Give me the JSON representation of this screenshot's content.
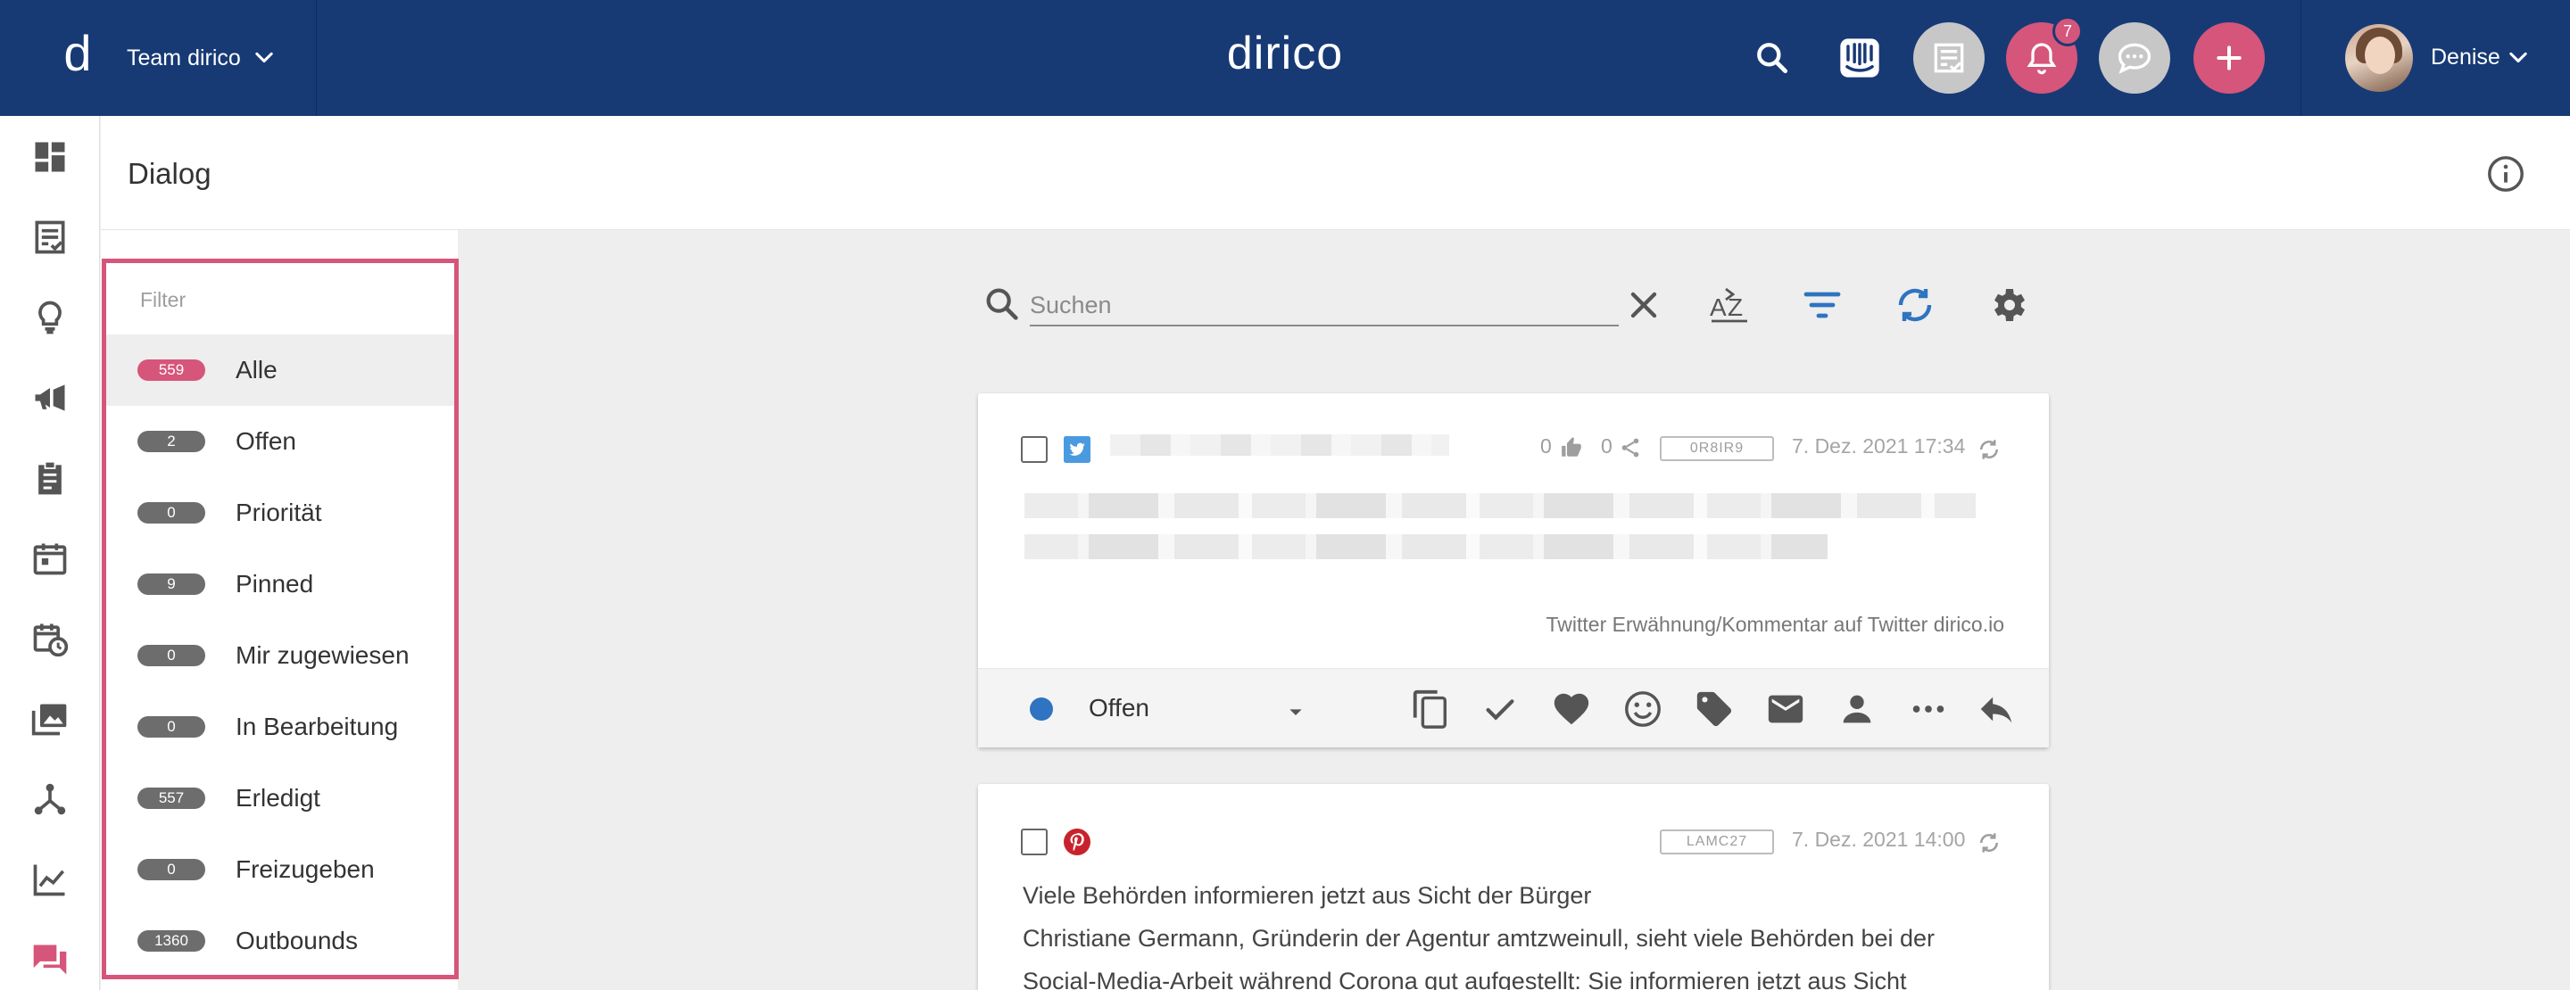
{
  "topbar": {
    "logo_letter": "d",
    "team_name": "Team dirico",
    "brand": "dirico",
    "notification_count": "7",
    "user_name": "Denise"
  },
  "header": {
    "title": "Dialog"
  },
  "filter": {
    "label": "Filter",
    "items": [
      {
        "count": "559",
        "label": "Alle"
      },
      {
        "count": "2",
        "label": "Offen"
      },
      {
        "count": "0",
        "label": "Priorität"
      },
      {
        "count": "9",
        "label": "Pinned"
      },
      {
        "count": "0",
        "label": "Mir zugewiesen"
      },
      {
        "count": "0",
        "label": "In Bearbeitung"
      },
      {
        "count": "557",
        "label": "Erledigt"
      },
      {
        "count": "0",
        "label": "Freizugeben"
      },
      {
        "count": "1360",
        "label": "Outbounds"
      }
    ]
  },
  "search": {
    "placeholder": "Suchen",
    "value": ""
  },
  "posts": [
    {
      "network": "twitter-icon",
      "likes": "0",
      "shares": "0",
      "id": "0R8IR9",
      "date": "7. Dez. 2021 17:34",
      "source": "Twitter Erwähnung/Kommentar auf Twitter dirico.io",
      "status": "Offen"
    },
    {
      "network": "pinterest-icon",
      "id": "LAMC27",
      "date": "7. Dez. 2021 14:00",
      "lines": [
        "Viele Behörden informieren jetzt aus Sicht der Bürger",
        "Christiane Germann, Gründerin der Agentur amtzweinull, sieht viele Behörden bei der",
        "Social-Media-Arbeit während Corona gut aufgestellt:  Sie informieren jetzt aus Sicht"
      ]
    }
  ],
  "colors": {
    "topbar": "#173a75",
    "accent": "#d6557a",
    "status_open": "#2e74c0",
    "twitter": "#4a9ae0",
    "pinterest": "#c8232c"
  }
}
